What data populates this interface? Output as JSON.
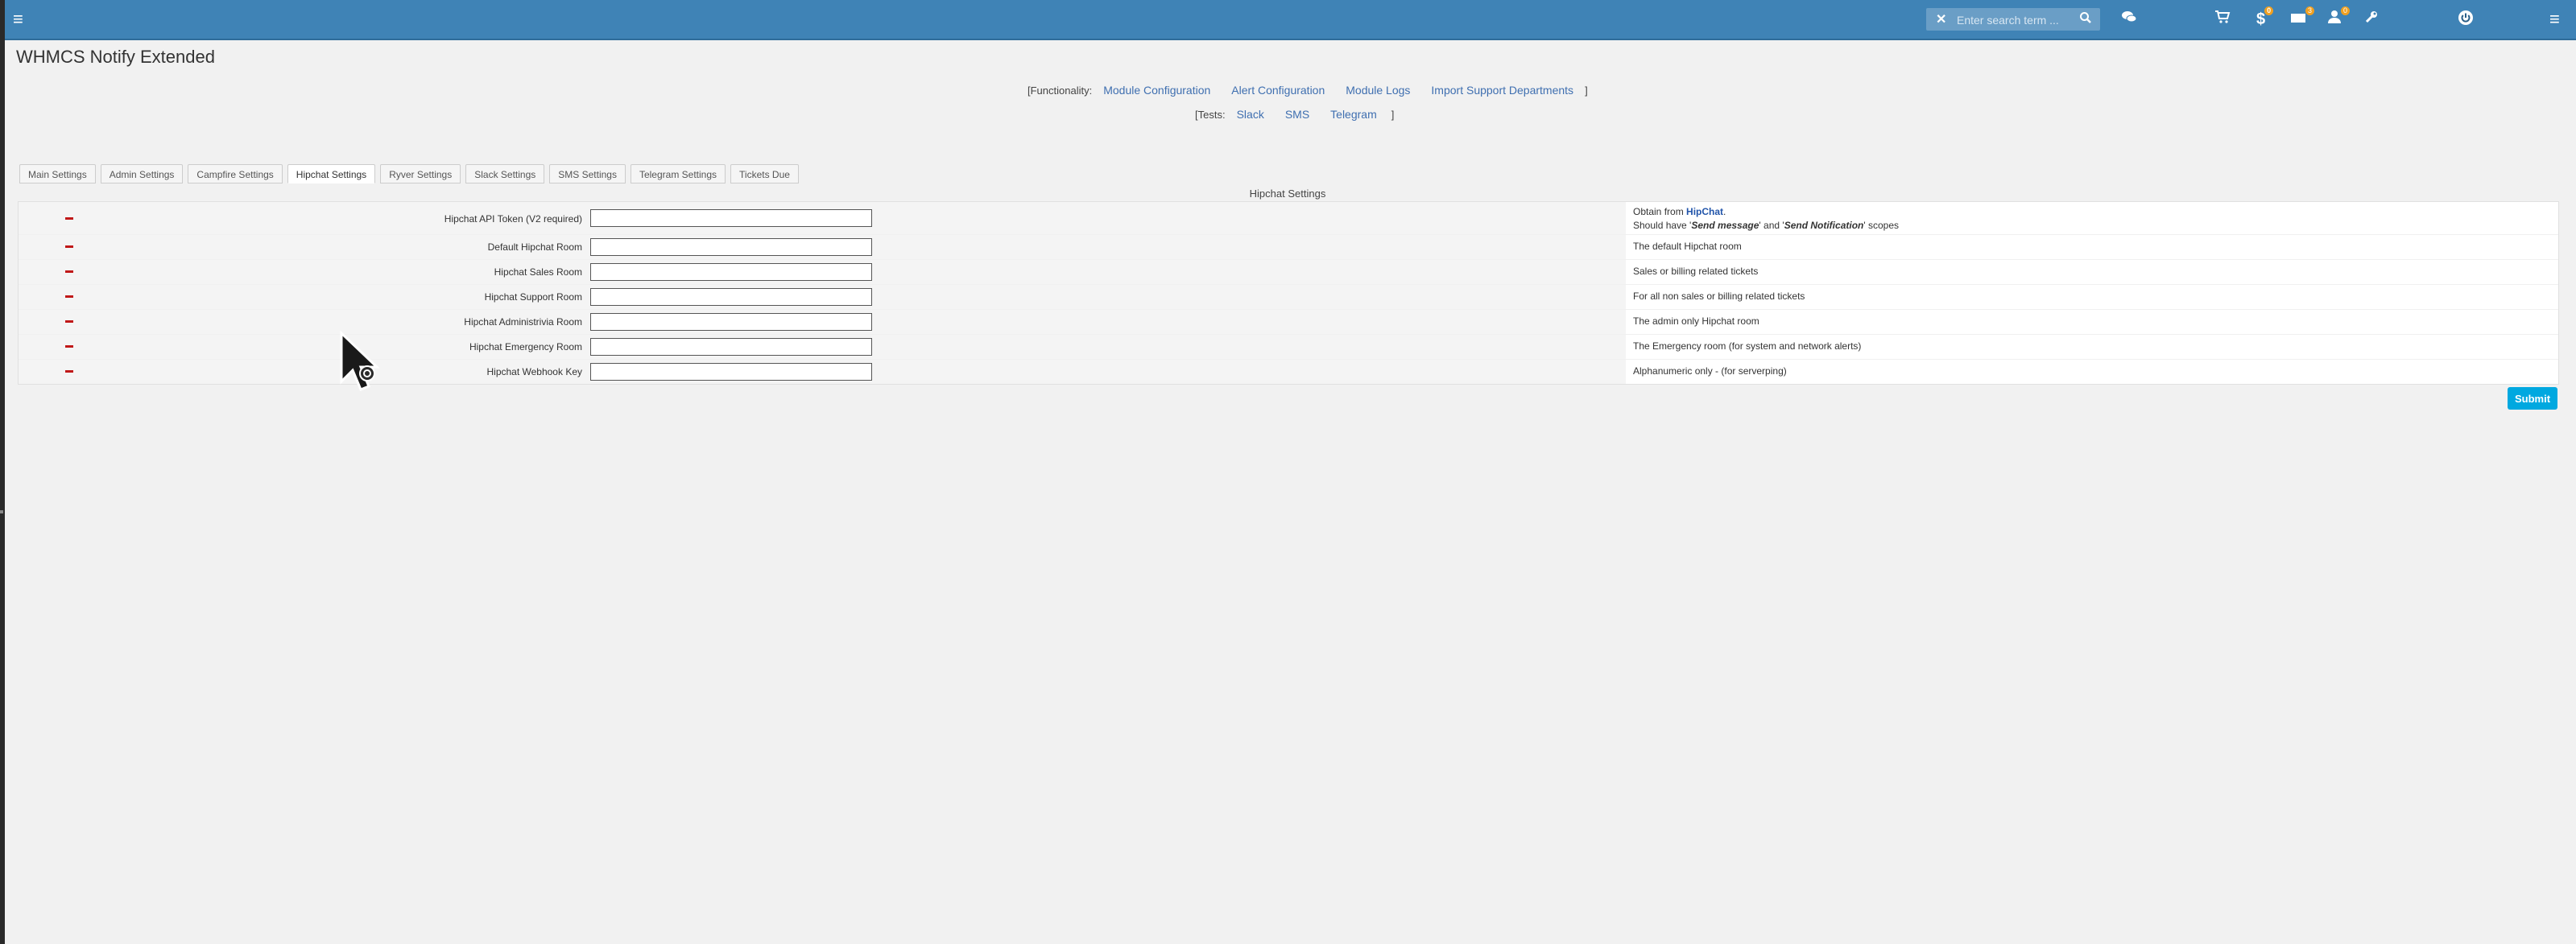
{
  "topbar": {
    "search_placeholder": "Enter search term ...",
    "badges": {
      "billing": "0",
      "tickets": "3",
      "users": "0"
    },
    "icons": [
      "menu-icon",
      "close-icon",
      "search-icon",
      "chat-icon",
      "cart-icon",
      "dollar-icon",
      "ticket-icon",
      "user-icon",
      "wrench-icon",
      "power-icon",
      "menu-icon"
    ]
  },
  "page": {
    "title": "WHMCS Notify Extended"
  },
  "functionality": {
    "prefix": "[Functionality:",
    "links": [
      "Module Configuration",
      "Alert Configuration",
      "Module Logs",
      "Import Support Departments"
    ],
    "suffix": "]"
  },
  "tests": {
    "prefix": "[Tests:",
    "links": [
      "Slack",
      "SMS",
      "Telegram"
    ],
    "suffix": "]"
  },
  "tabs": [
    "Main Settings",
    "Admin Settings",
    "Campfire Settings",
    "Hipchat Settings",
    "Ryver Settings",
    "Slack Settings",
    "SMS Settings",
    "Telegram Settings",
    "Tickets Due"
  ],
  "active_tab": "Hipchat Settings",
  "section": {
    "title": "Hipchat Settings"
  },
  "settings": [
    {
      "label": "Hipchat API Token (V2 required)",
      "value": "",
      "desc_pre": "Obtain from ",
      "desc_link": "HipChat",
      "desc_post": ".",
      "desc_line2_a": "Should have '",
      "desc_line2_b": "Send message",
      "desc_line2_c": "' and '",
      "desc_line2_d": "Send Notification",
      "desc_line2_e": "' scopes"
    },
    {
      "label": "Default Hipchat Room",
      "value": "",
      "desc": "The default Hipchat room"
    },
    {
      "label": "Hipchat Sales Room",
      "value": "",
      "desc": "Sales or billing related tickets"
    },
    {
      "label": "Hipchat Support Room",
      "value": "",
      "desc": "For all non sales or billing related tickets"
    },
    {
      "label": "Hipchat Administrivia Room",
      "value": "",
      "desc": "The admin only Hipchat room"
    },
    {
      "label": "Hipchat Emergency Room",
      "value": "",
      "desc": "The Emergency room (for system and network alerts)"
    },
    {
      "label": "Hipchat Webhook Key",
      "value": "",
      "desc": "Alphanumeric only - (for serverping)"
    }
  ],
  "submit_label": "Submit",
  "colors": {
    "topbar": "#3f83b6",
    "link": "#3f6fb0",
    "submit": "#00a8e0",
    "dash": "#c01818"
  }
}
